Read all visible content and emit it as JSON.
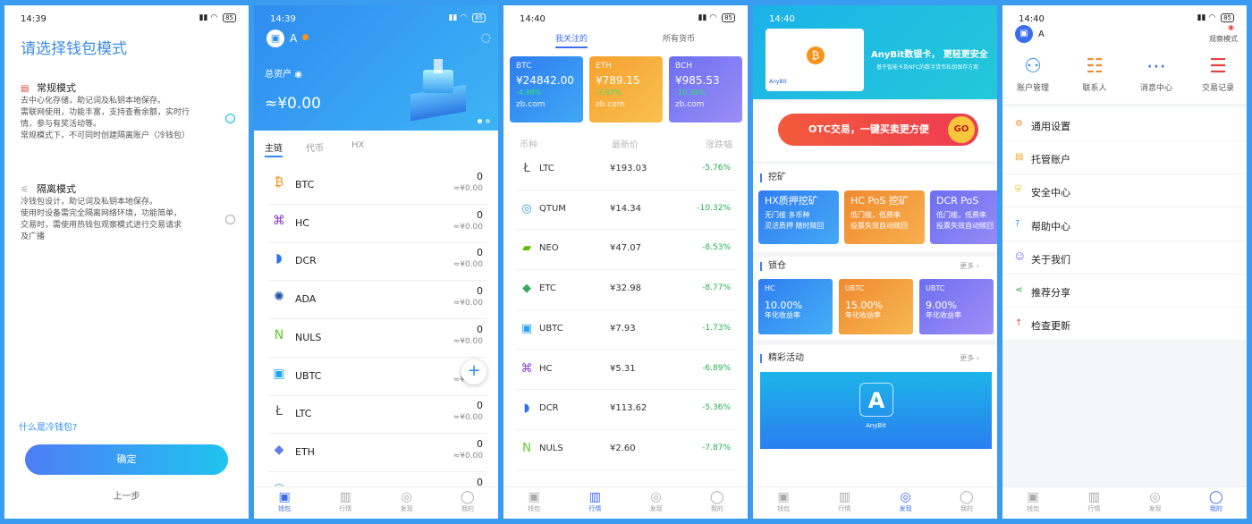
{
  "wallet_mode": {
    "time": "14:39",
    "battery": "85",
    "title": "请选择钱包模式",
    "standard": {
      "title": "常规模式",
      "lines": [
        "去中心化存储，助记词及私钥本地保存。",
        "需联网使用，功能丰富，支持查看余额，实时行",
        "情，参与有奖活动等。",
        "常规模式下，不可同时创建隔离账户（冷钱包）"
      ]
    },
    "isolated": {
      "title": "隔离模式",
      "lines": [
        "冷钱包设计，助记词及私钥本地保存。",
        "使用时设备需完全隔离网络环境，功能简单，",
        "交易时，需使用热钱包观察模式进行交易请求",
        "及广播"
      ]
    },
    "cold_wallet_link": "什么是冷钱包?",
    "confirm_label": "确定",
    "back_label": "上一步"
  },
  "wallet": {
    "time": "14:39",
    "battery": "85",
    "account": "A",
    "total_label": "总资产",
    "total_value": "≈¥0.00",
    "tabs": [
      "主链",
      "代币",
      "HX"
    ],
    "assets": [
      {
        "name": "BTC",
        "icon": "bitcoin-icon",
        "glyph": "₿",
        "color": "#f7931a",
        "amount": "0",
        "cny": "≈¥0.00"
      },
      {
        "name": "HC",
        "icon": "hc-icon",
        "glyph": "⌘",
        "color": "#8a3bd8",
        "amount": "0",
        "cny": "≈¥0.00"
      },
      {
        "name": "DCR",
        "icon": "dcr-icon",
        "glyph": "◗",
        "color": "#2970ff",
        "amount": "0",
        "cny": "≈¥0.00"
      },
      {
        "name": "ADA",
        "icon": "ada-icon",
        "glyph": "✺",
        "color": "#1b4fa8",
        "amount": "0",
        "cny": "≈¥0.00"
      },
      {
        "name": "NULS",
        "icon": "nuls-icon",
        "glyph": "N",
        "color": "#63c62c",
        "amount": "0",
        "cny": "≈¥0.00"
      },
      {
        "name": "UBTC",
        "icon": "ubtc-icon",
        "glyph": "▣",
        "color": "#1fa4f0",
        "amount": "0",
        "cny": "≈¥0.00"
      },
      {
        "name": "LTC",
        "icon": "ltc-icon",
        "glyph": "Ł",
        "color": "#555555",
        "amount": "0",
        "cny": "≈¥0.00"
      },
      {
        "name": "ETH",
        "icon": "eth-icon",
        "glyph": "◆",
        "color": "#627eea",
        "amount": "0",
        "cny": "≈¥0.00"
      },
      {
        "name": "QTUM",
        "icon": "qtum-icon",
        "glyph": "◎",
        "color": "#2e9ad0",
        "amount": "0",
        "cny": ""
      }
    ]
  },
  "market": {
    "time": "14:40",
    "battery": "85",
    "tabs": [
      "我关注的",
      "所有货币"
    ],
    "cards": [
      {
        "symbol": "BTC",
        "price": "¥24842.00",
        "change": "-4.98%",
        "source": "zb.com",
        "color": "linear-gradient(135deg,#2f7df0,#3fa8f5)"
      },
      {
        "symbol": "ETH",
        "price": "¥789.15",
        "change": "-7.97%",
        "source": "zb.com",
        "color": "linear-gradient(135deg,#f6a12e,#f8c050)"
      },
      {
        "symbol": "BCH",
        "price": "¥985.53",
        "change": "-10.36%",
        "source": "zb.com",
        "color": "linear-gradient(135deg,#6c6ff0,#9a8ef7)"
      }
    ],
    "headers": [
      "币种",
      "最新价",
      "涨跌幅"
    ],
    "rows": [
      {
        "name": "LTC",
        "glyph": "Ł",
        "color": "#555",
        "price": "¥193.03",
        "change": "-5.76%"
      },
      {
        "name": "QTUM",
        "glyph": "◎",
        "color": "#2e9ad0",
        "price": "¥14.34",
        "change": "-10.32%"
      },
      {
        "name": "NEO",
        "glyph": "▰",
        "color": "#58bf00",
        "price": "¥47.07",
        "change": "-8.53%"
      },
      {
        "name": "ETC",
        "glyph": "◆",
        "color": "#3aa860",
        "price": "¥32.98",
        "change": "-8.77%"
      },
      {
        "name": "UBTC",
        "glyph": "▣",
        "color": "#1fa4f0",
        "price": "¥7.93",
        "change": "-1.73%"
      },
      {
        "name": "HC",
        "glyph": "⌘",
        "color": "#8a3bd8",
        "price": "¥5.31",
        "change": "-6.89%"
      },
      {
        "name": "DCR",
        "glyph": "◗",
        "color": "#2970ff",
        "price": "¥113.62",
        "change": "-5.36%"
      },
      {
        "name": "NULS",
        "glyph": "N",
        "color": "#63c62c",
        "price": "¥2.60",
        "change": "-7.87%"
      }
    ]
  },
  "discover": {
    "time": "14:40",
    "banner_title": "AnyBit数银卡， 更轻更安全",
    "banner_sub": "基于智能卡及NFC的数字货币私钥保存方案",
    "otc_label": "OTC交易，一键买卖更方便",
    "otc_go": "GO",
    "mining_title": "挖矿",
    "mining": [
      {
        "title": "HX质押挖矿",
        "l1": "无门槛 多币种",
        "l2": "灵活质押 随时赎回",
        "color": "linear-gradient(135deg,#2f7df0,#45a8f6)"
      },
      {
        "title": "HC PoS 挖矿",
        "l1": "低门槛，低费率",
        "l2": "投票失效自动赎回",
        "color": "linear-gradient(135deg,#f08a2e,#f7b050)"
      },
      {
        "title": "DCR PoS",
        "l1": "低门槛，低费率",
        "l2": "投票失效自动赎回",
        "color": "linear-gradient(135deg,#6c6ff0,#9a8ef7)"
      }
    ],
    "lock_title": "锁仓",
    "more": "更多",
    "lock": [
      {
        "coin": "HC",
        "rate": "10.00%",
        "label": "年化收益率",
        "color": "linear-gradient(135deg,#2f7df0,#45b0f6)"
      },
      {
        "coin": "UBTC",
        "rate": "15.00%",
        "label": "年化收益率",
        "color": "linear-gradient(135deg,#f08a2e,#f7b854)"
      },
      {
        "coin": "UBTC",
        "rate": "9.00%",
        "label": "年化收益率",
        "color": "linear-gradient(135deg,#6c6ff0,#a08ff8)"
      }
    ],
    "events_title": "精彩活动",
    "event_brand": "AnyBit"
  },
  "mine": {
    "time": "14:40",
    "account": "A",
    "watch_mode": "观察模式",
    "quick": [
      {
        "label": "账户管理",
        "glyph": "⚇",
        "color": "#2a8ff0",
        "icon": "account-manage-icon"
      },
      {
        "label": "联系人",
        "glyph": "☷",
        "color": "#f08a2e",
        "icon": "contacts-icon"
      },
      {
        "label": "消息中心",
        "glyph": "⋯",
        "color": "#3c6cf0",
        "icon": "message-icon"
      },
      {
        "label": "交易记录",
        "glyph": "☰",
        "color": "#e84040",
        "icon": "records-icon"
      }
    ],
    "menu": [
      {
        "label": "通用设置",
        "glyph": "⚙",
        "color": "#f08a2e",
        "icon": "gear-icon"
      },
      {
        "label": "托管账户",
        "glyph": "▤",
        "color": "#f0a020",
        "icon": "custody-icon"
      },
      {
        "label": "安全中心",
        "glyph": "⛨",
        "color": "#f0c020",
        "icon": "shield-icon"
      },
      {
        "label": "帮助中心",
        "glyph": "?",
        "color": "#2a8ff0",
        "icon": "help-icon"
      },
      {
        "label": "关于我们",
        "glyph": "☺",
        "color": "#6c6ff0",
        "icon": "about-icon"
      },
      {
        "label": "推荐分享",
        "glyph": "⋖",
        "color": "#22b14c",
        "icon": "share-icon"
      },
      {
        "label": "检查更新",
        "glyph": "↑",
        "color": "#e84040",
        "icon": "update-icon"
      }
    ]
  },
  "tabbar": [
    "钱包",
    "行情",
    "发现",
    "我的"
  ]
}
